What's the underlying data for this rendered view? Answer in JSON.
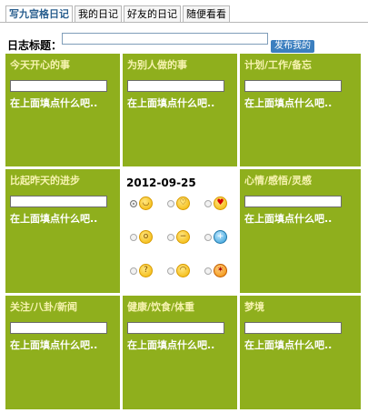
{
  "tabs": [
    {
      "label": "写九宫格日记",
      "active": true
    },
    {
      "label": "我的日记",
      "active": false
    },
    {
      "label": "好友的日记",
      "active": false
    },
    {
      "label": "随便看看",
      "active": false
    }
  ],
  "form": {
    "title_label": "日志标题：",
    "title_value": "",
    "publish_label": "发布我的"
  },
  "cells": [
    {
      "title": "今天开心的事",
      "hint": "在上面填点什么吧.."
    },
    {
      "title": "为别人做的事",
      "hint": "在上面填点什么吧.."
    },
    {
      "title": "计划/工作/备忘",
      "hint": "在上面填点什么吧.."
    },
    {
      "title": "比起昨天的进步",
      "hint": "在上面填点什么吧.."
    },
    {
      "title": "心情/感悟/灵感",
      "hint": "在上面填点什么吧.."
    },
    {
      "title": "关注/八卦/新闻",
      "hint": "在上面填点什么吧.."
    },
    {
      "title": "健康/饮食/体重",
      "hint": "在上面填点什么吧.."
    },
    {
      "title": "梦境",
      "hint": "在上面填点什么吧.."
    }
  ],
  "center": {
    "date": "2012-09-25",
    "moods": [
      {
        "icon": "smile-emoji-icon",
        "checked": true
      },
      {
        "icon": "blush-emoji-icon",
        "checked": false
      },
      {
        "icon": "heart-eyes-emoji-icon",
        "checked": false
      },
      {
        "icon": "surprised-emoji-icon",
        "checked": false
      },
      {
        "icon": "sleepy-emoji-icon",
        "checked": false
      },
      {
        "icon": "blue-face-emoji-icon",
        "checked": false
      },
      {
        "icon": "thinking-emoji-icon",
        "checked": false
      },
      {
        "icon": "grin-emoji-icon",
        "checked": false
      },
      {
        "icon": "angry-emoji-icon",
        "checked": false
      }
    ]
  },
  "colors": {
    "cell_bg": "#8faf1d",
    "cell_title": "#f7f3b0",
    "publish_bg": "#3c7fbf"
  }
}
